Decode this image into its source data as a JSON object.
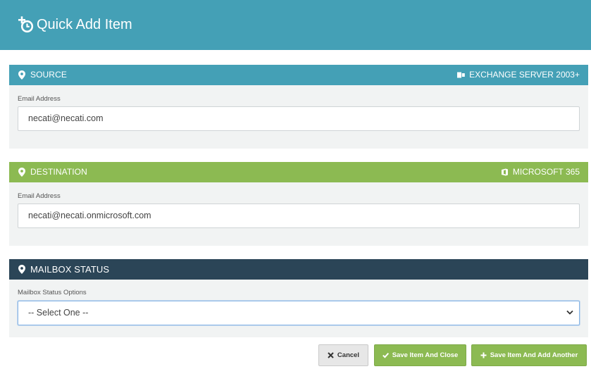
{
  "header": {
    "title": "Quick Add Item",
    "icon": "add-clock-icon"
  },
  "source": {
    "title": "SOURCE",
    "right_label": "EXCHANGE SERVER 2003+",
    "color": "#44a0b6",
    "field_label": "Email Address",
    "email_value": "necati@necati.com"
  },
  "destination": {
    "title": "DESTINATION",
    "right_label": "MICROSOFT 365",
    "color": "#8cba52",
    "field_label": "Email Address",
    "email_value": "necati@necati.onmicrosoft.com"
  },
  "mailbox": {
    "title": "MAILBOX STATUS",
    "color": "#2b4557",
    "field_label": "Mailbox Status Options",
    "selected": "-- Select One --"
  },
  "buttons": {
    "cancel": "Cancel",
    "save_close": "Save Item And Close",
    "save_add": "Save Item And Add Another"
  }
}
